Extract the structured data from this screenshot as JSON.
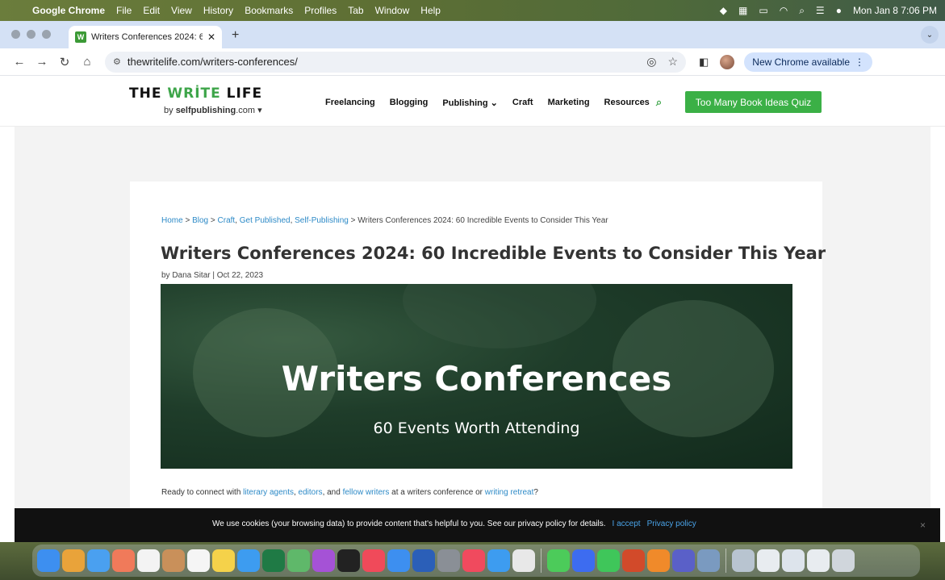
{
  "menubar": {
    "app_name": "Google Chrome",
    "items": [
      "File",
      "Edit",
      "View",
      "History",
      "Bookmarks",
      "Profiles",
      "Tab",
      "Window",
      "Help"
    ],
    "clock": "Mon Jan 8  7:06 PM"
  },
  "browser": {
    "tab_title": "Writers Conferences 2024: 6",
    "favicon_letter": "W",
    "url": "thewritelife.com/writers-conferences/",
    "update_label": "New Chrome available"
  },
  "site": {
    "logo_word1": "THE ",
    "logo_word2": "WRİTE",
    "logo_word3": " LIFE",
    "logo_by": "by ",
    "logo_brand": "selfpublishing",
    "logo_tld": ".com ▾",
    "nav": {
      "freelancing": "Freelancing",
      "blogging": "Blogging",
      "publishing": "Publishing ⌄",
      "craft": "Craft",
      "marketing": "Marketing",
      "resources": "Resources"
    },
    "cta": "Too Many Book Ideas Quiz"
  },
  "article": {
    "breadcrumb": {
      "home": "Home",
      "sep1": " > ",
      "blog": "Blog",
      "sep2": " > ",
      "craft": "Craft",
      "comma1": ", ",
      "get_published": "Get Published",
      "comma2": ", ",
      "self_publishing": "Self-Publishing",
      "sep3": " > ",
      "current": "Writers Conferences 2024: 60 Incredible Events to Consider This Year"
    },
    "title": "Writers Conferences 2024: 60 Incredible Events to Consider This Year",
    "byline": "by Dana Sitar | Oct 22, 2023",
    "hero_title": "Writers Conferences",
    "hero_subtitle": "60 Events Worth Attending",
    "intro": {
      "t1": "Ready to connect with ",
      "l1": "literary agents",
      "t2": ", ",
      "l2": "editors",
      "t3": ", and ",
      "l3": "fellow writers",
      "t4": " at a writers conference or ",
      "l4": "writing retreat",
      "t5": "?"
    }
  },
  "cookie": {
    "text": "We use cookies (your browsing data) to provide content that's helpful to you. See our privacy policy for details.",
    "accept": "I accept",
    "policy": "Privacy policy",
    "close": "×"
  },
  "dock": {
    "icons": [
      {
        "name": "finder-icon",
        "color": "#3d8ff0"
      },
      {
        "name": "launchpad-icon",
        "color": "#e9a33a"
      },
      {
        "name": "mail-icon",
        "color": "#4aa0f0"
      },
      {
        "name": "photos-icon",
        "color": "#f07a5a"
      },
      {
        "name": "calendar-icon",
        "color": "#f3f3f3"
      },
      {
        "name": "contacts-icon",
        "color": "#c9905a"
      },
      {
        "name": "reminders-icon",
        "color": "#f5f5f5"
      },
      {
        "name": "notes-icon",
        "color": "#f5d24a"
      },
      {
        "name": "app-store-icon",
        "color": "#3d9cf0"
      },
      {
        "name": "excel-icon",
        "color": "#1f7a45"
      },
      {
        "name": "maps-icon",
        "color": "#5fb86a"
      },
      {
        "name": "podcasts-icon",
        "color": "#a552d6"
      },
      {
        "name": "apple-tv-icon",
        "color": "#222222"
      },
      {
        "name": "news-icon",
        "color": "#f04a5a"
      },
      {
        "name": "keynote-icon",
        "color": "#3d8ff0"
      },
      {
        "name": "word-icon",
        "color": "#2b5fb8"
      },
      {
        "name": "system-settings-icon",
        "color": "#8a8f96"
      },
      {
        "name": "music-icon",
        "color": "#f04a5e"
      },
      {
        "name": "safari-icon",
        "color": "#3d9cf0"
      },
      {
        "name": "chrome-icon",
        "color": "#e8e8e8"
      },
      {
        "name": "messages-icon",
        "color": "#4ccb5a"
      },
      {
        "name": "nordvpn-icon",
        "color": "#3d6cf0"
      },
      {
        "name": "whatsapp-icon",
        "color": "#3fc65a"
      },
      {
        "name": "powerpoint-icon",
        "color": "#d24a2a"
      },
      {
        "name": "books-icon",
        "color": "#f08a2a"
      },
      {
        "name": "teams-icon",
        "color": "#5a60c8"
      },
      {
        "name": "preview-icon",
        "color": "#7a9ac0"
      },
      {
        "name": "recent-doc-1-icon",
        "color": "#b8c4d0"
      },
      {
        "name": "recent-doc-2-icon",
        "color": "#e8ecf0"
      },
      {
        "name": "recent-doc-3-icon",
        "color": "#dde4ec"
      },
      {
        "name": "recent-doc-4-icon",
        "color": "#e8ecf0"
      },
      {
        "name": "trash-icon",
        "color": "#d0d6dc"
      }
    ]
  },
  "colors": {
    "brand_green": "#3bb046",
    "link_blue": "#2d8ac7",
    "cookie_bg": "#111111"
  }
}
